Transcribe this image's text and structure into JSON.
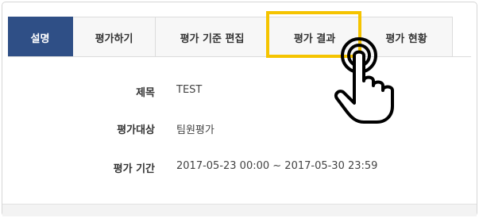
{
  "tabs": [
    {
      "label": "설명",
      "active": true
    },
    {
      "label": "평가하기",
      "active": false
    },
    {
      "label": "평가 기준 편집",
      "active": false
    },
    {
      "label": "평가 결과",
      "active": false
    },
    {
      "label": "평가 현황",
      "active": false
    }
  ],
  "fields": {
    "title_label": "제목",
    "title_value": "TEST",
    "target_label": "평가대상",
    "target_value": "팀원평가",
    "period_label": "평가 기간",
    "period_value": "2017-05-23 00:00 ~ 2017-05-30 23:59"
  },
  "colors": {
    "active_tab": "#2f4f86",
    "highlight": "#f5c400"
  },
  "icons": {
    "pointer": "hand-pointer-icon"
  }
}
